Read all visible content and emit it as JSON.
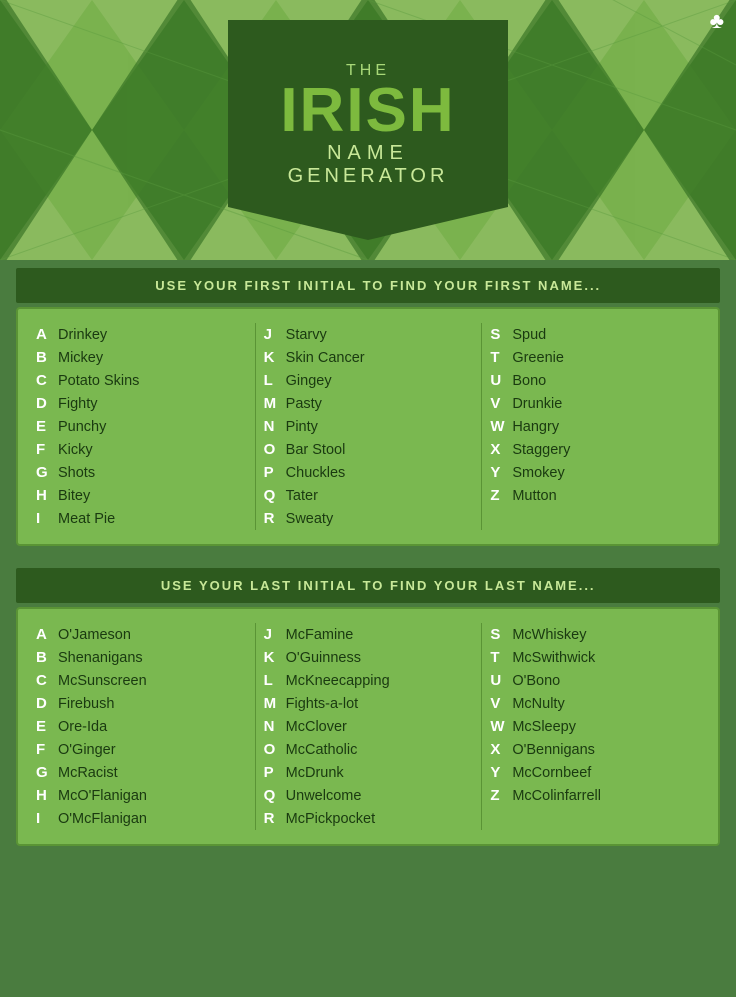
{
  "header": {
    "the": "THE",
    "irish": "IRISH",
    "name": "NAME",
    "generator": "GENERATOR"
  },
  "section1": {
    "title": "1. USE YOUR FIRST INITIAL TO FIND YOUR FIRST NAME...",
    "col1": [
      {
        "letter": "A",
        "name": "Drinkey"
      },
      {
        "letter": "B",
        "name": "Mickey"
      },
      {
        "letter": "C",
        "name": "Potato Skins"
      },
      {
        "letter": "D",
        "name": "Fighty"
      },
      {
        "letter": "E",
        "name": "Punchy"
      },
      {
        "letter": "F",
        "name": "Kicky"
      },
      {
        "letter": "G",
        "name": "Shots"
      },
      {
        "letter": "H",
        "name": "Bitey"
      },
      {
        "letter": "I",
        "name": "Meat Pie"
      }
    ],
    "col2": [
      {
        "letter": "J",
        "name": "Starvy"
      },
      {
        "letter": "K",
        "name": "Skin Cancer"
      },
      {
        "letter": "L",
        "name": "Gingey"
      },
      {
        "letter": "M",
        "name": "Pasty"
      },
      {
        "letter": "N",
        "name": "Pinty"
      },
      {
        "letter": "O",
        "name": "Bar Stool"
      },
      {
        "letter": "P",
        "name": "Chuckles"
      },
      {
        "letter": "Q",
        "name": "Tater"
      },
      {
        "letter": "R",
        "name": "Sweaty"
      }
    ],
    "col3": [
      {
        "letter": "S",
        "name": "Spud"
      },
      {
        "letter": "T",
        "name": "Greenie"
      },
      {
        "letter": "U",
        "name": "Bono"
      },
      {
        "letter": "V",
        "name": "Drunkie"
      },
      {
        "letter": "W",
        "name": "Hangry"
      },
      {
        "letter": "X",
        "name": "Staggery"
      },
      {
        "letter": "Y",
        "name": "Smokey"
      },
      {
        "letter": "Z",
        "name": "Mutton"
      }
    ]
  },
  "section2": {
    "title": "2. USE YOUR LAST INITIAL TO FIND YOUR LAST NAME...",
    "col1": [
      {
        "letter": "A",
        "name": "O'Jameson"
      },
      {
        "letter": "B",
        "name": "Shenanigans"
      },
      {
        "letter": "C",
        "name": "McSunscreen"
      },
      {
        "letter": "D",
        "name": "Firebush"
      },
      {
        "letter": "E",
        "name": "Ore-Ida"
      },
      {
        "letter": "F",
        "name": "O'Ginger"
      },
      {
        "letter": "G",
        "name": "McRacist"
      },
      {
        "letter": "H",
        "name": "McO'Flanigan"
      },
      {
        "letter": "I",
        "name": "O'McFlanigan"
      }
    ],
    "col2": [
      {
        "letter": "J",
        "name": "McFamine"
      },
      {
        "letter": "K",
        "name": "O'Guinness"
      },
      {
        "letter": "L",
        "name": "McKneecapping"
      },
      {
        "letter": "M",
        "name": "Fights-a-lot"
      },
      {
        "letter": "N",
        "name": "McClover"
      },
      {
        "letter": "O",
        "name": "McCatholic"
      },
      {
        "letter": "P",
        "name": "McDrunk"
      },
      {
        "letter": "Q",
        "name": "Unwelcome"
      },
      {
        "letter": "R",
        "name": "McPickpocket"
      }
    ],
    "col3": [
      {
        "letter": "S",
        "name": "McWhiskey"
      },
      {
        "letter": "T",
        "name": "McSwithwick"
      },
      {
        "letter": "U",
        "name": "O'Bono"
      },
      {
        "letter": "V",
        "name": "McNulty"
      },
      {
        "letter": "W",
        "name": "McSleepy"
      },
      {
        "letter": "X",
        "name": "O'Bennigans"
      },
      {
        "letter": "Y",
        "name": "McCornbeef"
      },
      {
        "letter": "Z",
        "name": "McColinfarrell"
      }
    ]
  }
}
